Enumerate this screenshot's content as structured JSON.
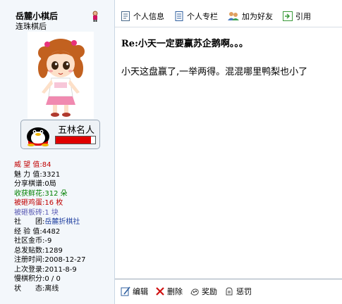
{
  "user": {
    "name": "岳麓小棋后",
    "title": "连珠棋后",
    "rank_label": "五林名人",
    "rank_progress": 0.9
  },
  "stats": [
    {
      "label": "威 望 值:",
      "value": "84",
      "color": "#c00000"
    },
    {
      "label": "魅 力 值:",
      "value": "3321",
      "color": "#000000"
    },
    {
      "label": "分享棋谱:",
      "value": "0局",
      "color": "#000000"
    },
    {
      "label": "收获鲜花:",
      "value": "312 朵",
      "color": "#008000"
    },
    {
      "label": "被砸鸡蛋:",
      "value": "16 枚",
      "color": "#c00000"
    },
    {
      "label": "被砸板砖:",
      "value": "1 块",
      "color": "#5a5ab4"
    },
    {
      "label": "社　　团:",
      "value": "岳麓折棋社",
      "color": "#000000",
      "value_color": "#2040a0"
    },
    {
      "label": "经 验 值:",
      "value": "4482",
      "color": "#000000"
    },
    {
      "label": "社区金币:",
      "value": "-9",
      "color": "#000000"
    },
    {
      "label": "总发贴数:",
      "value": "1289",
      "color": "#000000"
    },
    {
      "label": "注册时间:",
      "value": "2008-12-27",
      "color": "#000000"
    },
    {
      "label": "上次登录:",
      "value": "2011-8-9",
      "color": "#000000"
    },
    {
      "label": "慢棋积分:",
      "value": "0 / 0",
      "color": "#000000"
    },
    {
      "label": "状　　态:",
      "value": "离线",
      "color": "#000000"
    }
  ],
  "toolbar": {
    "profile_label": "个人信息",
    "column_label": "个人专栏",
    "add_friend_label": "加为好友",
    "quote_label": "引用"
  },
  "post": {
    "title": "Re:小天一定要赢苏企鹅啊。。。",
    "body": "小天这盘赢了,一举两得。混混哪里鸭梨也小了"
  },
  "footer": {
    "edit_label": "编辑",
    "delete_label": "删除",
    "reward_label": "奖励",
    "punish_label": "惩罚"
  }
}
